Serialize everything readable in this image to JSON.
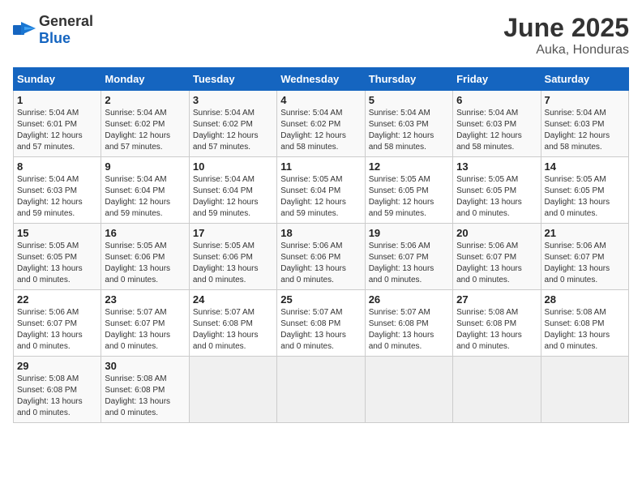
{
  "logo": {
    "general": "General",
    "blue": "Blue"
  },
  "title": {
    "month": "June 2025",
    "location": "Auka, Honduras"
  },
  "weekdays": [
    "Sunday",
    "Monday",
    "Tuesday",
    "Wednesday",
    "Thursday",
    "Friday",
    "Saturday"
  ],
  "weeks": [
    [
      {
        "day": "1",
        "info": "Sunrise: 5:04 AM\nSunset: 6:01 PM\nDaylight: 12 hours\nand 57 minutes."
      },
      {
        "day": "2",
        "info": "Sunrise: 5:04 AM\nSunset: 6:02 PM\nDaylight: 12 hours\nand 57 minutes."
      },
      {
        "day": "3",
        "info": "Sunrise: 5:04 AM\nSunset: 6:02 PM\nDaylight: 12 hours\nand 57 minutes."
      },
      {
        "day": "4",
        "info": "Sunrise: 5:04 AM\nSunset: 6:02 PM\nDaylight: 12 hours\nand 58 minutes."
      },
      {
        "day": "5",
        "info": "Sunrise: 5:04 AM\nSunset: 6:03 PM\nDaylight: 12 hours\nand 58 minutes."
      },
      {
        "day": "6",
        "info": "Sunrise: 5:04 AM\nSunset: 6:03 PM\nDaylight: 12 hours\nand 58 minutes."
      },
      {
        "day": "7",
        "info": "Sunrise: 5:04 AM\nSunset: 6:03 PM\nDaylight: 12 hours\nand 58 minutes."
      }
    ],
    [
      {
        "day": "8",
        "info": "Sunrise: 5:04 AM\nSunset: 6:03 PM\nDaylight: 12 hours\nand 59 minutes."
      },
      {
        "day": "9",
        "info": "Sunrise: 5:04 AM\nSunset: 6:04 PM\nDaylight: 12 hours\nand 59 minutes."
      },
      {
        "day": "10",
        "info": "Sunrise: 5:04 AM\nSunset: 6:04 PM\nDaylight: 12 hours\nand 59 minutes."
      },
      {
        "day": "11",
        "info": "Sunrise: 5:05 AM\nSunset: 6:04 PM\nDaylight: 12 hours\nand 59 minutes."
      },
      {
        "day": "12",
        "info": "Sunrise: 5:05 AM\nSunset: 6:05 PM\nDaylight: 12 hours\nand 59 minutes."
      },
      {
        "day": "13",
        "info": "Sunrise: 5:05 AM\nSunset: 6:05 PM\nDaylight: 13 hours\nand 0 minutes."
      },
      {
        "day": "14",
        "info": "Sunrise: 5:05 AM\nSunset: 6:05 PM\nDaylight: 13 hours\nand 0 minutes."
      }
    ],
    [
      {
        "day": "15",
        "info": "Sunrise: 5:05 AM\nSunset: 6:05 PM\nDaylight: 13 hours\nand 0 minutes."
      },
      {
        "day": "16",
        "info": "Sunrise: 5:05 AM\nSunset: 6:06 PM\nDaylight: 13 hours\nand 0 minutes."
      },
      {
        "day": "17",
        "info": "Sunrise: 5:05 AM\nSunset: 6:06 PM\nDaylight: 13 hours\nand 0 minutes."
      },
      {
        "day": "18",
        "info": "Sunrise: 5:06 AM\nSunset: 6:06 PM\nDaylight: 13 hours\nand 0 minutes."
      },
      {
        "day": "19",
        "info": "Sunrise: 5:06 AM\nSunset: 6:07 PM\nDaylight: 13 hours\nand 0 minutes."
      },
      {
        "day": "20",
        "info": "Sunrise: 5:06 AM\nSunset: 6:07 PM\nDaylight: 13 hours\nand 0 minutes."
      },
      {
        "day": "21",
        "info": "Sunrise: 5:06 AM\nSunset: 6:07 PM\nDaylight: 13 hours\nand 0 minutes."
      }
    ],
    [
      {
        "day": "22",
        "info": "Sunrise: 5:06 AM\nSunset: 6:07 PM\nDaylight: 13 hours\nand 0 minutes."
      },
      {
        "day": "23",
        "info": "Sunrise: 5:07 AM\nSunset: 6:07 PM\nDaylight: 13 hours\nand 0 minutes."
      },
      {
        "day": "24",
        "info": "Sunrise: 5:07 AM\nSunset: 6:08 PM\nDaylight: 13 hours\nand 0 minutes."
      },
      {
        "day": "25",
        "info": "Sunrise: 5:07 AM\nSunset: 6:08 PM\nDaylight: 13 hours\nand 0 minutes."
      },
      {
        "day": "26",
        "info": "Sunrise: 5:07 AM\nSunset: 6:08 PM\nDaylight: 13 hours\nand 0 minutes."
      },
      {
        "day": "27",
        "info": "Sunrise: 5:08 AM\nSunset: 6:08 PM\nDaylight: 13 hours\nand 0 minutes."
      },
      {
        "day": "28",
        "info": "Sunrise: 5:08 AM\nSunset: 6:08 PM\nDaylight: 13 hours\nand 0 minutes."
      }
    ],
    [
      {
        "day": "29",
        "info": "Sunrise: 5:08 AM\nSunset: 6:08 PM\nDaylight: 13 hours\nand 0 minutes."
      },
      {
        "day": "30",
        "info": "Sunrise: 5:08 AM\nSunset: 6:08 PM\nDaylight: 13 hours\nand 0 minutes."
      },
      {
        "day": "",
        "info": ""
      },
      {
        "day": "",
        "info": ""
      },
      {
        "day": "",
        "info": ""
      },
      {
        "day": "",
        "info": ""
      },
      {
        "day": "",
        "info": ""
      }
    ]
  ]
}
